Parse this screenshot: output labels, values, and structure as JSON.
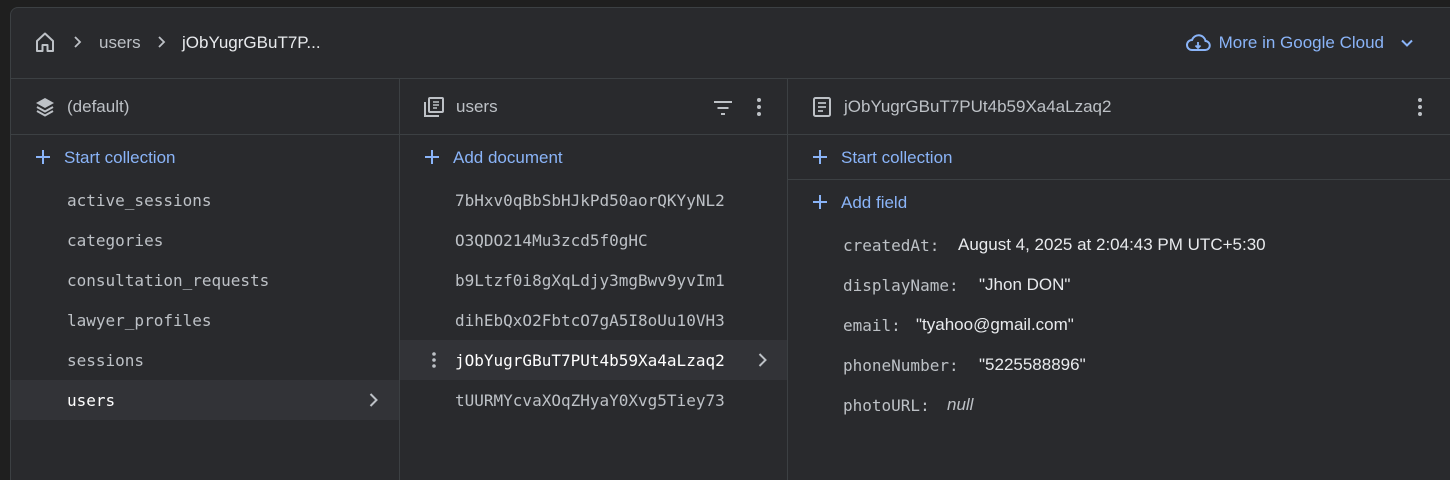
{
  "breadcrumb": {
    "items": [
      "users",
      "jObYugrGBuT7P..."
    ]
  },
  "cloud_button": {
    "label": "More in Google Cloud"
  },
  "panel_root": {
    "title": "(default)",
    "action": "Start collection",
    "collections": [
      "active_sessions",
      "categories",
      "consultation_requests",
      "lawyer_profiles",
      "sessions",
      "users"
    ],
    "selected_index": 5
  },
  "panel_collection": {
    "title": "users",
    "action": "Add document",
    "documents": [
      "7bHxv0qBbSbHJkPd50aorQKYyNL2",
      "O3QDO214Mu3zcd5f0gHC",
      "b9Ltzf0i8gXqLdjy3mgBwv9yvIm1",
      "dihEbQxO2FbtcO7gA5I8oUu10VH3",
      "jObYugrGBuT7PUt4b59Xa4aLzaq2",
      "tUURMYcvaXOqZHyaY0Xvg5Tiey73"
    ],
    "selected_index": 4
  },
  "panel_document": {
    "title": "jObYugrGBuT7PUt4b59Xa4aLzaq2",
    "action_collection": "Start collection",
    "action_field": "Add field",
    "fields": [
      {
        "key": "createdAt:",
        "value": "August 4, 2025 at 2:04:43 PM UTC+5:30"
      },
      {
        "key": "displayName:",
        "value": "\"Jhon DON\""
      },
      {
        "key": "email:",
        "value": "\"tyahoo@gmail.com\""
      },
      {
        "key": "phoneNumber:",
        "value": "\"5225588896\""
      },
      {
        "key": "photoURL:",
        "value": "null"
      }
    ]
  },
  "colors": {
    "background": "#292a2d",
    "accent": "#8ab4f8",
    "border": "#3c4043",
    "selected_row": "#323337"
  },
  "icons": [
    "home-icon",
    "chevron-right-icon",
    "cloud-icon",
    "chevron-down-icon",
    "stack-icon",
    "collection-icon",
    "filter-icon",
    "more-vert-icon",
    "document-icon",
    "plus-icon"
  ]
}
